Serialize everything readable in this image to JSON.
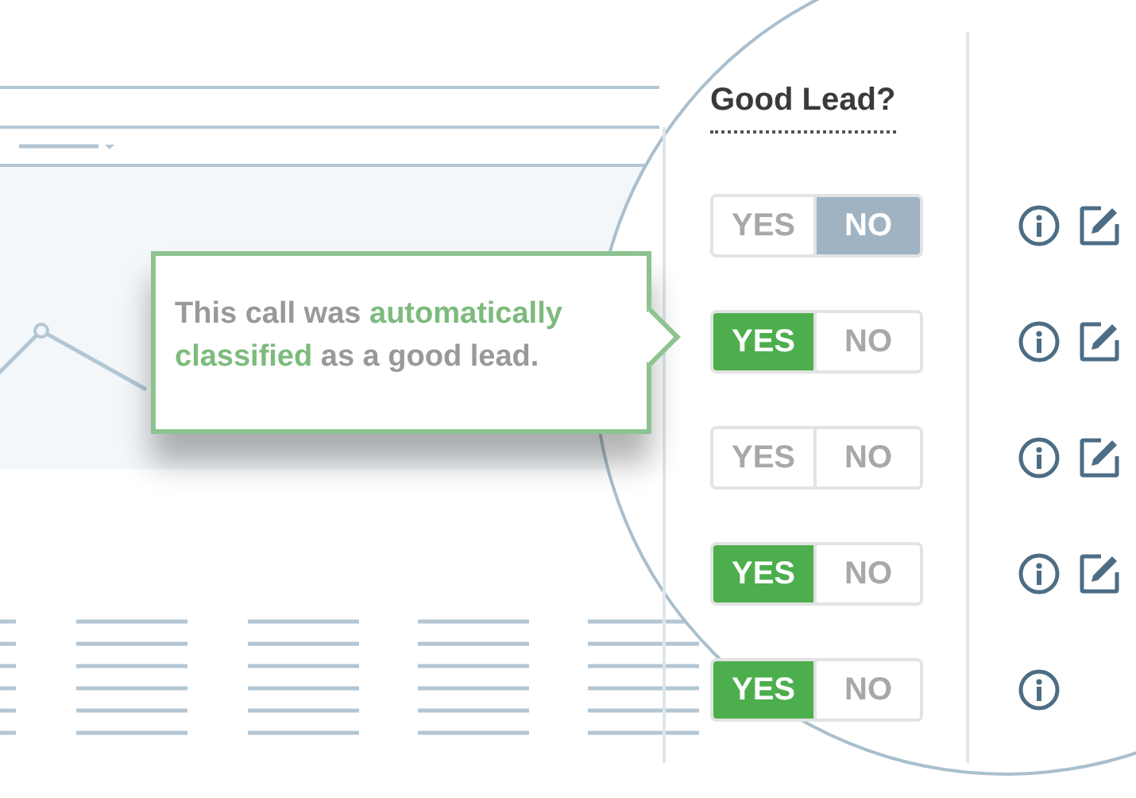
{
  "callout": {
    "text": "This call was **automatically classified** as a good lead."
  },
  "column_header": "Good Lead?",
  "rows": [
    {
      "yes": {
        "label": "YES",
        "selected": false
      },
      "no": {
        "label": "NO",
        "selected": true
      },
      "edit": true
    },
    {
      "yes": {
        "label": "YES",
        "selected": true
      },
      "no": {
        "label": "NO",
        "selected": false
      },
      "edit": true
    },
    {
      "yes": {
        "label": "YES",
        "selected": false
      },
      "no": {
        "label": "NO",
        "selected": false
      },
      "edit": true
    },
    {
      "yes": {
        "label": "YES",
        "selected": true
      },
      "no": {
        "label": "NO",
        "selected": false
      },
      "edit": true
    },
    {
      "yes": {
        "label": "YES",
        "selected": true
      },
      "no": {
        "label": "NO",
        "selected": false
      },
      "edit": false
    }
  ]
}
